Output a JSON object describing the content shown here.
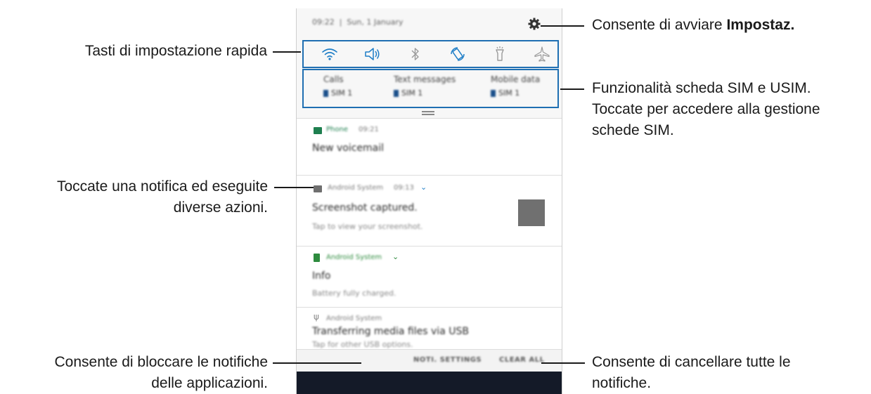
{
  "phone": {
    "status_time": "09:22",
    "status_date": "Sun, 1 January",
    "quick_settings": [
      "wifi-icon",
      "sound-icon",
      "bluetooth-icon",
      "auto-rotate-icon",
      "flashlight-icon",
      "airplane-mode-icon"
    ],
    "sim": [
      {
        "title": "Calls",
        "sub": "SIM 1"
      },
      {
        "title": "Text messages",
        "sub": "SIM 1"
      },
      {
        "title": "Mobile data",
        "sub": "SIM 1"
      }
    ],
    "notifications": [
      {
        "app": "Phone",
        "time": "09:21",
        "title": "New voicemail",
        "sub": ""
      },
      {
        "app": "Android System",
        "time": "09:13",
        "title": "Screenshot captured.",
        "sub": "Tap to view your screenshot."
      },
      {
        "app": "Android System",
        "time": "",
        "title": "Info",
        "sub": "Battery fully charged."
      },
      {
        "app": "Android System",
        "time": "",
        "title": "Transferring media files via USB",
        "sub": "Tap for other USB options."
      }
    ],
    "buttons": {
      "notif_settings": "NOTI. SETTINGS",
      "clear_all": "CLEAR ALL"
    }
  },
  "callouts": {
    "settings_prefix": "Consente di avviare ",
    "settings_bold": "Impostaz.",
    "quick_settings": "Tasti di impostazione rapida",
    "sim_line1": "Funzionalità scheda SIM e USIM.",
    "sim_line2": "Toccate per accedere alla gestione",
    "sim_line3": "schede SIM.",
    "notif_line1": "Toccate una notifica ed eseguite",
    "notif_line2": "diverse azioni.",
    "block_line1": "Consente di bloccare le notifiche",
    "block_line2": "delle applicazioni.",
    "clear_line1": "Consente di cancellare tutte le",
    "clear_line2": "notifiche."
  },
  "colors": {
    "highlight": "#1f6fb2",
    "nav_bar": "#141a28",
    "phone_app": "#1e7f4f",
    "battery_green": "#2e8b3e"
  }
}
